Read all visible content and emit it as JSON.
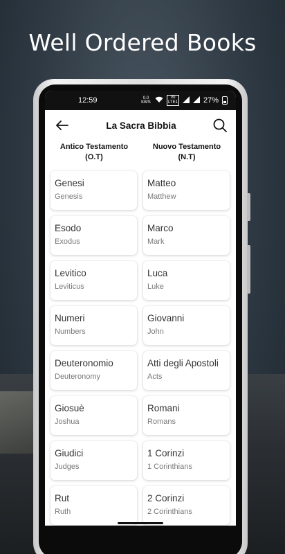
{
  "promo": {
    "headline": "Well Ordered Books"
  },
  "status_bar": {
    "time": "12:59",
    "speed": "0.0 KB/S",
    "network_badge": "Vo LTE1",
    "battery": "27%"
  },
  "app_bar": {
    "title": "La Sacra Bibbia",
    "back_icon": "arrow-left-icon",
    "search_icon": "search-icon"
  },
  "columns": {
    "old_testament": {
      "line1": "Antico Testamento",
      "line2": "(O.T)"
    },
    "new_testament": {
      "line1": "Nuovo Testamento",
      "line2": "(N.T)"
    }
  },
  "old_testament_books": [
    {
      "name": "Genesi",
      "english": "Genesis"
    },
    {
      "name": "Esodo",
      "english": "Exodus"
    },
    {
      "name": "Levitico",
      "english": "Leviticus"
    },
    {
      "name": "Numeri",
      "english": "Numbers"
    },
    {
      "name": "Deuteronomio",
      "english": "Deuteronomy"
    },
    {
      "name": "Giosuè",
      "english": "Joshua"
    },
    {
      "name": "Giudici",
      "english": "Judges"
    },
    {
      "name": "Rut",
      "english": "Ruth"
    }
  ],
  "new_testament_books": [
    {
      "name": "Matteo",
      "english": "Matthew"
    },
    {
      "name": "Marco",
      "english": "Mark"
    },
    {
      "name": "Luca",
      "english": "Luke"
    },
    {
      "name": "Giovanni",
      "english": "John"
    },
    {
      "name": "Atti degli Apostoli",
      "english": "Acts"
    },
    {
      "name": "Romani",
      "english": "Romans"
    },
    {
      "name": "1 Corinzi",
      "english": "1 Corinthians"
    },
    {
      "name": "2 Corinzi",
      "english": "2 Corinthians"
    }
  ]
}
